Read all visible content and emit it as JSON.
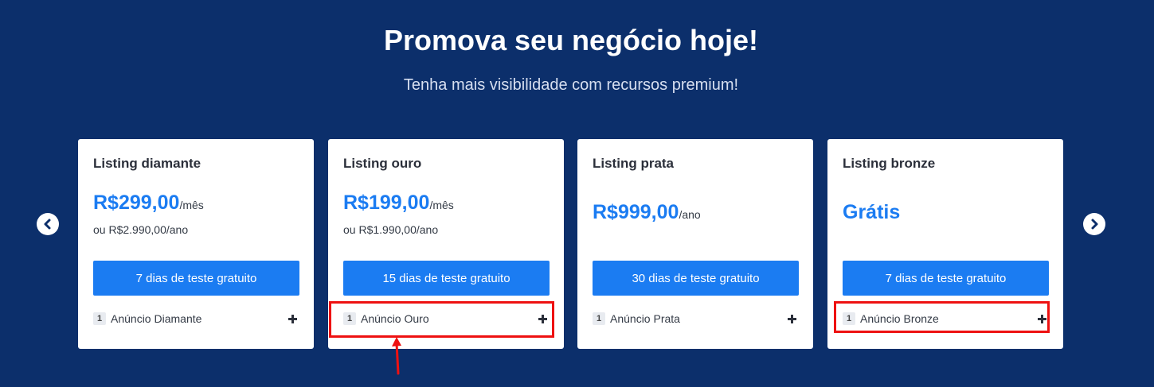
{
  "header": {
    "title": "Promova seu negócio hoje!",
    "subtitle": "Tenha mais visibilidade com recursos premium!"
  },
  "nav": {
    "prev_icon": "chevron-left-icon",
    "next_icon": "chevron-right-icon"
  },
  "plans": [
    {
      "name": "Listing diamante",
      "price": "R$299,00",
      "period": "/mês",
      "alt_price": "ou R$2.990,00/ano",
      "trial_label": "7 dias de teste gratuito",
      "feature_qty": "1",
      "feature_label": "Anúncio Diamante"
    },
    {
      "name": "Listing ouro",
      "price": "R$199,00",
      "period": "/mês",
      "alt_price": "ou R$1.990,00/ano",
      "trial_label": "15 dias de teste gratuito",
      "feature_qty": "1",
      "feature_label": "Anúncio Ouro"
    },
    {
      "name": "Listing prata",
      "price": "R$999,00",
      "period": "/ano",
      "trial_label": "30 dias de teste gratuito",
      "feature_qty": "1",
      "feature_label": "Anúncio Prata"
    },
    {
      "name": "Listing bronze",
      "price": "Grátis",
      "trial_label": "7 dias de teste gratuito",
      "feature_qty": "1",
      "feature_label": "Anúncio Bronze"
    }
  ],
  "colors": {
    "background": "#0c2f6b",
    "accent": "#1b7cf2",
    "annotation": "#ee1111"
  }
}
